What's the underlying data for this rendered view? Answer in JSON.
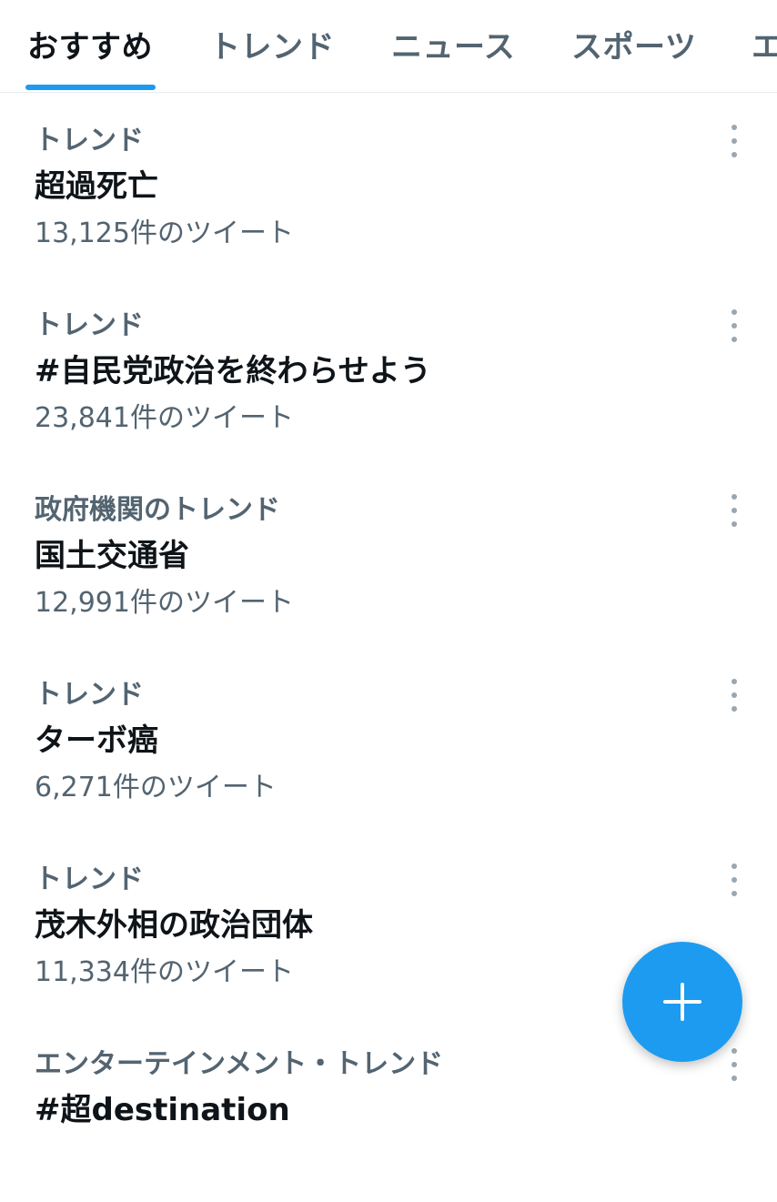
{
  "tabs": [
    {
      "label": "おすすめ",
      "active": true
    },
    {
      "label": "トレンド",
      "active": false
    },
    {
      "label": "ニュース",
      "active": false
    },
    {
      "label": "スポーツ",
      "active": false
    },
    {
      "label": "エ",
      "active": false
    }
  ],
  "trends": [
    {
      "context": "トレンド",
      "title": "超過死亡",
      "tweets": "13,125件のツイート"
    },
    {
      "context": "トレンド",
      "title": "#自民党政治を終わらせよう",
      "tweets": "23,841件のツイート"
    },
    {
      "context": "政府機関のトレンド",
      "title": "国土交通省",
      "tweets": "12,991件のツイート"
    },
    {
      "context": "トレンド",
      "title": "ターボ癌",
      "tweets": "6,271件のツイート"
    },
    {
      "context": "トレンド",
      "title": "茂木外相の政治団体",
      "tweets": "11,334件のツイート"
    },
    {
      "context": "エンターテインメント・トレンド",
      "title": "#超destination",
      "tweets": ""
    }
  ],
  "fab": {
    "icon": "plus-icon",
    "color": "#1d9bf0"
  },
  "colors": {
    "accent": "#1d9bf0",
    "secondary_text": "#536471",
    "primary_text": "#0f1419"
  }
}
